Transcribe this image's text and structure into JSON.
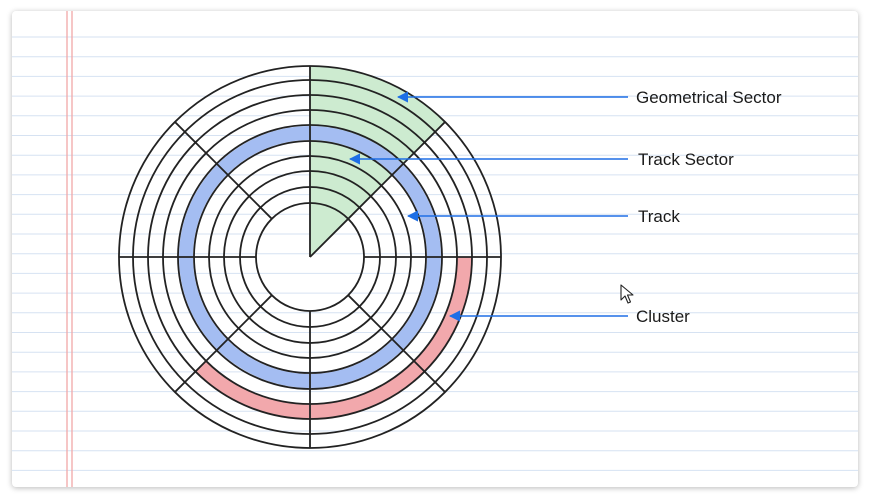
{
  "labels": {
    "geometrical_sector": "Geometrical Sector",
    "track_sector": "Track Sector",
    "track": "Track",
    "cluster": "Cluster"
  },
  "colors": {
    "sector_fill": "#cdebd0",
    "track_fill": "#a4bdf2",
    "cluster_fill": "#f2a8ac",
    "arrow": "#1e6fe6",
    "rule_line": "#d6e2f2",
    "margin_line": "#f2a7a7",
    "disk_stroke": "#222222"
  },
  "icons": {
    "cursor": "mouse-pointer-icon"
  }
}
